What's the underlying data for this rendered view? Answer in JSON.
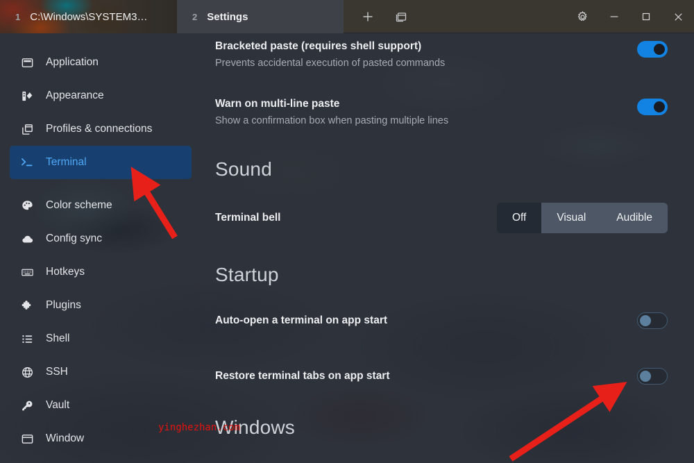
{
  "window": {
    "tabs": [
      {
        "number": "1",
        "title": "C:\\Windows\\SYSTEM3…",
        "active": false
      },
      {
        "number": "2",
        "title": "Settings",
        "active": true
      }
    ],
    "tabbar_actions": [
      {
        "name": "new-tab-icon",
        "label": "+"
      },
      {
        "name": "split-pane-icon",
        "label": "▣"
      }
    ],
    "controls": [
      {
        "name": "settings-gear-icon",
        "label": "⚙"
      },
      {
        "name": "minimize-icon",
        "label": "—"
      },
      {
        "name": "maximize-icon",
        "label": "□"
      },
      {
        "name": "close-icon",
        "label": "✕"
      }
    ]
  },
  "sidebar": {
    "items": [
      {
        "label": "Application",
        "icon": "window-icon"
      },
      {
        "label": "Appearance",
        "icon": "palette-swatch-icon"
      },
      {
        "label": "Profiles & connections",
        "icon": "copy-windows-icon"
      },
      {
        "label": "Terminal",
        "icon": "terminal-prompt-icon",
        "active": true
      },
      {
        "label": "Color scheme",
        "icon": "paint-palette-icon"
      },
      {
        "label": "Config sync",
        "icon": "cloud-icon"
      },
      {
        "label": "Hotkeys",
        "icon": "keyboard-icon"
      },
      {
        "label": "Plugins",
        "icon": "puzzle-piece-icon"
      },
      {
        "label": "Shell",
        "icon": "list-icon"
      },
      {
        "label": "SSH",
        "icon": "globe-icon"
      },
      {
        "label": "Vault",
        "icon": "key-icon"
      },
      {
        "label": "Window",
        "icon": "window-frame-icon"
      }
    ]
  },
  "main": {
    "settings": [
      {
        "label": "Bracketed paste (requires shell support)",
        "desc": "Prevents accidental execution of pasted commands",
        "state": "on"
      },
      {
        "label": "Warn on multi-line paste",
        "desc": "Show a confirmation box when pasting multiple lines",
        "state": "on"
      }
    ],
    "sound": {
      "title": "Sound",
      "bell": {
        "label": "Terminal bell",
        "options": [
          "Off",
          "Visual",
          "Audible"
        ],
        "selected": "Off"
      }
    },
    "startup": {
      "title": "Startup",
      "items": [
        {
          "label": "Auto-open a terminal on app start",
          "state": "off"
        },
        {
          "label": "Restore terminal tabs on app start",
          "state": "off"
        }
      ]
    },
    "windows": {
      "title": "Windows"
    }
  },
  "watermark": {
    "text": "yinghezhan.com"
  },
  "colors": {
    "accent_blue": "#4fa8f5",
    "toggle_on": "#1283e2",
    "selected_nav_bg": "#174070",
    "annotation_red": "#e8201a",
    "panel_bg": "#2e323a"
  }
}
